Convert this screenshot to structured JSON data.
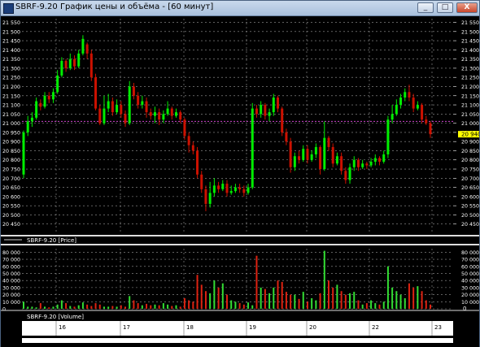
{
  "window": {
    "title": "SBRF-9.20 График цены и объёма - [60 минут]",
    "minimize_glyph": "_",
    "maximize_glyph": "□",
    "close_glyph": "X"
  },
  "colors": {
    "background": "#000000",
    "up": "#00ee00",
    "down": "#cc1100",
    "volume_up": "#33dd33",
    "volume_down": "#dd2211",
    "grid": "#9a9a9a",
    "text": "#ffffff",
    "level_line": "#cc44cc",
    "last_price_box": "#ffff00"
  },
  "price_panel": {
    "legend": "SBRF-9.20 [Price]",
    "last_price_label": "20 940",
    "level_line_value": 21010,
    "y_ticks": [
      "21 550",
      "21 500",
      "21 450",
      "21 400",
      "21 350",
      "21 300",
      "21 250",
      "21 200",
      "21 150",
      "21 100",
      "21 050",
      "21 000",
      "20 950",
      "20 900",
      "20 850",
      "20 800",
      "20 750",
      "20 700",
      "20 650",
      "20 600",
      "20 550",
      "20 500",
      "20 450"
    ]
  },
  "volume_panel": {
    "legend": "SBRF-9.20 [Volume]",
    "y_ticks": [
      "80 000",
      "70 000",
      "60 000",
      "50 000",
      "40 000",
      "30 000",
      "20 000",
      "10 000",
      "0"
    ],
    "right_bottom_label": "0"
  },
  "time_axis": {
    "labels": [
      "16",
      "17",
      "18",
      "19",
      "20",
      "22",
      "23"
    ]
  },
  "chart_data": [
    {
      "type": "candlestick",
      "title": "",
      "ylabel": "",
      "ylim": [
        20400,
        21570
      ],
      "x_categories": [
        "16",
        "17",
        "18",
        "19",
        "20",
        "22",
        "23"
      ],
      "candles": [
        [
          20720,
          20950,
          20700,
          20960
        ],
        [
          20950,
          21010,
          20930,
          21040
        ],
        [
          21010,
          21030,
          20980,
          21060
        ],
        [
          21030,
          21120,
          21020,
          21140
        ],
        [
          21110,
          21090,
          21070,
          21130
        ],
        [
          21090,
          21150,
          21080,
          21170
        ],
        [
          21150,
          21130,
          21110,
          21170
        ],
        [
          21130,
          21170,
          21110,
          21190
        ],
        [
          21170,
          21260,
          21160,
          21290
        ],
        [
          21260,
          21340,
          21250,
          21360
        ],
        [
          21340,
          21300,
          21280,
          21350
        ],
        [
          21300,
          21350,
          21290,
          21380
        ],
        [
          21350,
          21310,
          21290,
          21370
        ],
        [
          21310,
          21380,
          21300,
          21400
        ],
        [
          21380,
          21460,
          21370,
          21480
        ],
        [
          21430,
          21380,
          21350,
          21440
        ],
        [
          21380,
          21250,
          21230,
          21400
        ],
        [
          21250,
          21080,
          21070,
          21270
        ],
        [
          21080,
          21000,
          20990,
          21100
        ],
        [
          21000,
          21080,
          20990,
          21150
        ],
        [
          21080,
          21120,
          21060,
          21160
        ],
        [
          21120,
          21060,
          21040,
          21140
        ],
        [
          21060,
          21100,
          21050,
          21130
        ],
        [
          21100,
          21050,
          21030,
          21120
        ],
        [
          21050,
          21000,
          20980,
          21070
        ],
        [
          21000,
          21200,
          20990,
          21230
        ],
        [
          21200,
          21150,
          21130,
          21220
        ],
        [
          21150,
          21100,
          21080,
          21170
        ],
        [
          21100,
          21120,
          21080,
          21150
        ],
        [
          21120,
          21060,
          21030,
          21140
        ],
        [
          21060,
          21040,
          21020,
          21080
        ],
        [
          21040,
          21060,
          21000,
          21090
        ],
        [
          21060,
          21020,
          20990,
          21080
        ],
        [
          21020,
          21050,
          21000,
          21070
        ],
        [
          21050,
          21080,
          21040,
          21120
        ],
        [
          21080,
          21040,
          21020,
          21090
        ],
        [
          21040,
          21060,
          21030,
          21080
        ],
        [
          21060,
          21020,
          21000,
          21070
        ],
        [
          21020,
          20930,
          20910,
          21030
        ],
        [
          20930,
          20880,
          20840,
          20950
        ],
        [
          20880,
          20850,
          20830,
          20900
        ],
        [
          20850,
          20720,
          20700,
          20870
        ],
        [
          20720,
          20640,
          20620,
          20740
        ],
        [
          20640,
          20560,
          20520,
          20660
        ],
        [
          20560,
          20620,
          20540,
          20680
        ],
        [
          20620,
          20660,
          20600,
          20700
        ],
        [
          20660,
          20640,
          20620,
          20680
        ],
        [
          20640,
          20670,
          20630,
          20690
        ],
        [
          20670,
          20620,
          20600,
          20690
        ],
        [
          20620,
          20630,
          20610,
          20660
        ],
        [
          20630,
          20650,
          20620,
          20670
        ],
        [
          20650,
          20640,
          20620,
          20670
        ],
        [
          20640,
          20620,
          20600,
          20660
        ],
        [
          20620,
          20650,
          20610,
          20670
        ],
        [
          20650,
          21080,
          20640,
          21110
        ],
        [
          21080,
          21050,
          21030,
          21100
        ],
        [
          21050,
          21100,
          21030,
          21120
        ],
        [
          21100,
          21040,
          21020,
          21110
        ],
        [
          21040,
          21060,
          21010,
          21080
        ],
        [
          21060,
          21140,
          21040,
          21160
        ],
        [
          21140,
          21080,
          21060,
          21150
        ],
        [
          21080,
          20950,
          20930,
          21090
        ],
        [
          20950,
          20900,
          20880,
          20970
        ],
        [
          20900,
          20760,
          20730,
          20920
        ],
        [
          20760,
          20820,
          20740,
          20840
        ],
        [
          20820,
          20800,
          20780,
          20850
        ],
        [
          20800,
          20860,
          20790,
          20880
        ],
        [
          20860,
          20800,
          20780,
          20880
        ],
        [
          20800,
          20830,
          20790,
          20850
        ],
        [
          20830,
          20870,
          20810,
          20890
        ],
        [
          20870,
          20750,
          20720,
          20880
        ],
        [
          20750,
          20920,
          20740,
          21010
        ],
        [
          20920,
          20870,
          20850,
          20930
        ],
        [
          20870,
          20780,
          20760,
          20890
        ],
        [
          20780,
          20820,
          20770,
          20840
        ],
        [
          20820,
          20740,
          20720,
          20840
        ],
        [
          20740,
          20690,
          20670,
          20760
        ],
        [
          20690,
          20760,
          20670,
          20780
        ],
        [
          20760,
          20800,
          20740,
          20820
        ],
        [
          20800,
          20760,
          20740,
          20810
        ],
        [
          20760,
          20780,
          20750,
          20800
        ],
        [
          20780,
          20770,
          20750,
          20790
        ],
        [
          20770,
          20790,
          20760,
          20810
        ],
        [
          20790,
          20810,
          20770,
          20830
        ],
        [
          20810,
          20790,
          20770,
          20820
        ],
        [
          20790,
          20830,
          20780,
          20850
        ],
        [
          20830,
          21020,
          20810,
          21040
        ],
        [
          21020,
          21050,
          21000,
          21100
        ],
        [
          21050,
          21100,
          21040,
          21130
        ],
        [
          21100,
          21140,
          21080,
          21160
        ],
        [
          21140,
          21170,
          21120,
          21190
        ],
        [
          21170,
          21140,
          21120,
          21210
        ],
        [
          21140,
          21080,
          21060,
          21160
        ],
        [
          21080,
          21100,
          21070,
          21120
        ],
        [
          21100,
          21020,
          21000,
          21110
        ],
        [
          21020,
          21000,
          20990,
          21040
        ],
        [
          21000,
          20940,
          20920,
          21010
        ]
      ]
    },
    {
      "type": "bar",
      "title": "",
      "ylabel": "",
      "ylim": [
        0,
        85000
      ],
      "values": [
        10000,
        3000,
        3000,
        2000,
        8000,
        3000,
        2000,
        3000,
        6000,
        12000,
        8000,
        4000,
        3000,
        5000,
        9000,
        6000,
        4000,
        8000,
        6000,
        3000,
        3000,
        4000,
        3000,
        5000,
        3000,
        18000,
        12000,
        8000,
        5000,
        7000,
        5000,
        6000,
        5000,
        8000,
        6000,
        4000,
        5000,
        3000,
        15000,
        12000,
        10000,
        48000,
        34000,
        25000,
        22000,
        40000,
        30000,
        36000,
        20000,
        12000,
        10000,
        8000,
        6000,
        9000,
        5000,
        75000,
        30000,
        28000,
        22000,
        30000,
        40000,
        38000,
        24000,
        20000,
        20000,
        14000,
        24000,
        10000,
        15000,
        12000,
        22000,
        82000,
        40000,
        30000,
        34000,
        25000,
        20000,
        22000,
        24000,
        12000,
        6000,
        8000,
        12000,
        8000,
        6000,
        10000,
        60000,
        30000,
        25000,
        20000,
        15000,
        36000,
        30000,
        32000,
        25000,
        12000,
        6000
      ],
      "direction": [
        "up",
        "up",
        "up",
        "up",
        "down",
        "up",
        "down",
        "up",
        "up",
        "up",
        "down",
        "up",
        "down",
        "up",
        "up",
        "down",
        "down",
        "down",
        "down",
        "up",
        "up",
        "down",
        "up",
        "down",
        "down",
        "up",
        "down",
        "down",
        "up",
        "down",
        "down",
        "up",
        "down",
        "up",
        "up",
        "down",
        "up",
        "down",
        "down",
        "down",
        "down",
        "down",
        "down",
        "down",
        "up",
        "up",
        "down",
        "up",
        "down",
        "up",
        "up",
        "down",
        "down",
        "up",
        "up",
        "down",
        "up",
        "down",
        "up",
        "up",
        "down",
        "down",
        "down",
        "down",
        "up",
        "down",
        "up",
        "down",
        "up",
        "up",
        "down",
        "up",
        "down",
        "down",
        "up",
        "down",
        "down",
        "up",
        "up",
        "down",
        "up",
        "down",
        "up",
        "up",
        "down",
        "up",
        "up",
        "up",
        "up",
        "up",
        "up",
        "down",
        "down",
        "up",
        "down",
        "down",
        "down"
      ]
    }
  ]
}
